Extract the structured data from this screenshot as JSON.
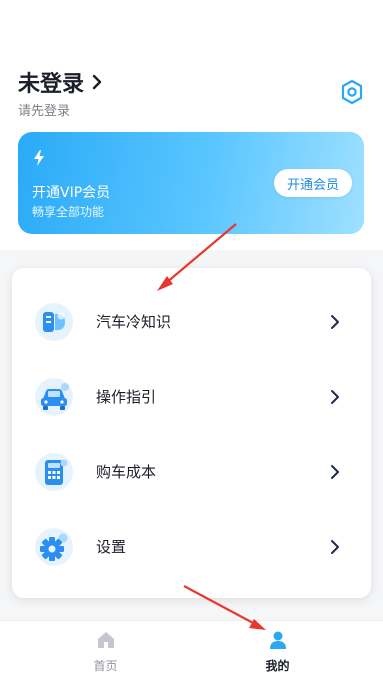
{
  "profile": {
    "title": "未登录",
    "subtitle": "请先登录"
  },
  "vip": {
    "title": "开通VIP会员",
    "description": "畅享全部功能",
    "button_label": "开通会员"
  },
  "menu": {
    "items": [
      {
        "label": "汽车冷知识",
        "icon": "book-icon"
      },
      {
        "label": "操作指引",
        "icon": "car-icon"
      },
      {
        "label": "购车成本",
        "icon": "calculator-icon"
      },
      {
        "label": "设置",
        "icon": "gear-icon"
      }
    ]
  },
  "tabbar": {
    "items": [
      {
        "label": "首页",
        "icon": "home-icon",
        "active": false
      },
      {
        "label": "我的",
        "icon": "user-icon",
        "active": true
      }
    ]
  },
  "colors": {
    "accent": "#2aa8f2",
    "annotation": "#e8372f"
  }
}
